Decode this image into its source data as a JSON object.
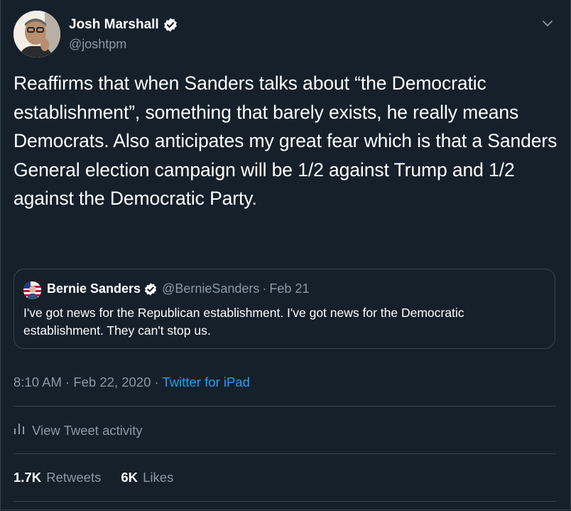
{
  "author": {
    "name": "Josh Marshall",
    "handle": "@joshtpm"
  },
  "tweet": {
    "text": "Reaffirms that when Sanders talks about “the Democratic establishment”, something that barely exists, he really means Democrats. Also anticipates my great fear which is that a Sanders General election campaign will be 1/2 against Trump and 1/2 against the Democratic Party."
  },
  "quoted_tweet": {
    "name": "Bernie Sanders",
    "handle": "@BernieSanders",
    "separator": "·",
    "date": "Feb 21",
    "text": "I've got news for the Republican establishment. I've got news for the Democratic establishment. They can't stop us."
  },
  "meta": {
    "time": "8:10 AM",
    "separator1": "·",
    "date": "Feb 22, 2020",
    "separator2": "·",
    "source": "Twitter for iPad"
  },
  "activity": {
    "label": "View Tweet activity"
  },
  "stats": {
    "retweets_count": "1.7K",
    "retweets_label": "Retweets",
    "likes_count": "6K",
    "likes_label": "Likes"
  },
  "colors": {
    "background": "#15202b",
    "border": "#38444d",
    "secondary_text": "#8899a6",
    "accent": "#1da1f2"
  },
  "icons": [
    "verified-badge-icon",
    "chevron-down-icon",
    "bar-chart-icon"
  ]
}
